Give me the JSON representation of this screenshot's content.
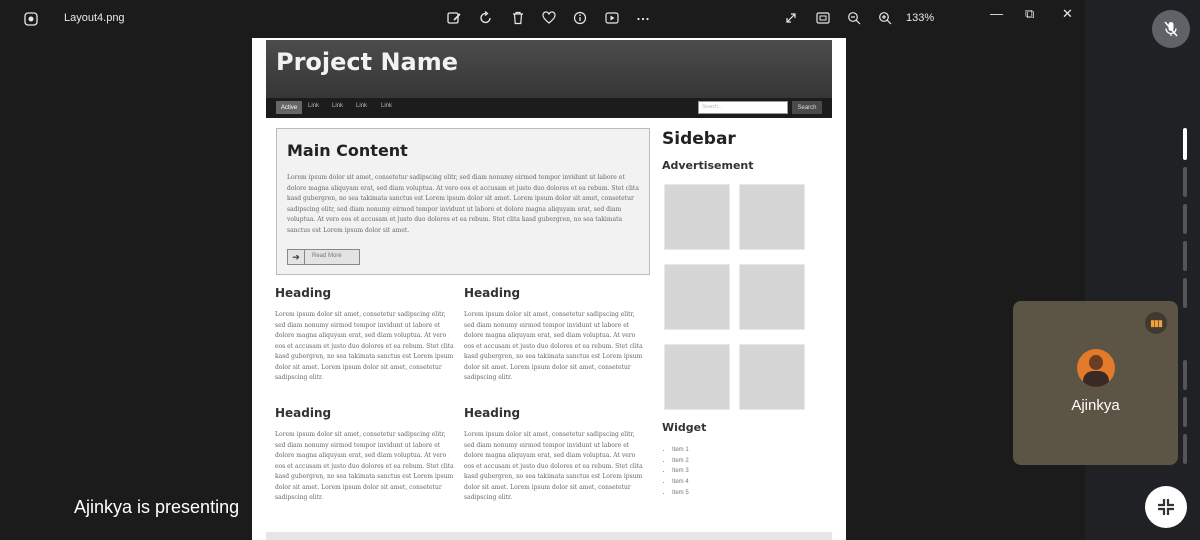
{
  "viewer": {
    "filename": "Layout4.png",
    "zoom": "133%",
    "toolbar_icons": [
      "edit-image-icon",
      "rotate-icon",
      "delete-icon",
      "favorite-icon",
      "info-icon",
      "slideshow-icon",
      "more-icon"
    ],
    "right_icons": [
      "fullscreen-icon",
      "fit-screen-icon",
      "zoom-out-icon",
      "zoom-in-icon"
    ],
    "window_controls": {
      "minimize": "—",
      "restore": "⧉",
      "close": "✕"
    }
  },
  "layout": {
    "project_name": "Project Name",
    "nav": {
      "active": "Active",
      "links": [
        "Link",
        "Link",
        "Link",
        "Link"
      ],
      "search_placeholder": "Search...",
      "search_button": "Search"
    },
    "main": {
      "title": "Main Content",
      "text": "Lorem ipsum dolor sit amet, consetetur sadipscing elitr, sed diam nonumy eirmod tempor invidunt ut labore et dolore magna aliquyam erat, sed diam voluptua. At vero eos et accusam et justo duo dolores et ea rebum. Stet clita kasd gubergren, no sea takimata sanctus est Lorem ipsum dolor sit amet. Lorem ipsum dolor sit amet, consetetur sadipscing elitr, sed diam nonumy eirmod tempor invidunt ut labore et dolore magna aliquyam erat, sed diam voluptua. At vero eos et accusam et justo duo dolores et ea rebum. Stet clita kasd gubergren, no sea takimata sanctus est Lorem ipsum dolor sit amet.",
      "read_more": "Read More"
    },
    "columns": [
      {
        "heading": "Heading",
        "text": "Lorem ipsum dolor sit amet, consetetur sadipscing elitr, sed diam nonumy eirmod tempor invidunt ut labore et dolore magna aliquyam erat, sed diam voluptua. At vero eos et accusam et justo duo dolores et ea rebum. Stet clita kasd gubergren, no sea takimata sanctus est Lorem ipsum dolor sit amet. Lorem ipsum dolor sit amet, consetetur sadipscing elitr."
      },
      {
        "heading": "Heading",
        "text": "Lorem ipsum dolor sit amet, consetetur sadipscing elitr, sed diam nonumy eirmod tempor invidunt ut labore et dolore magna aliquyam erat, sed diam voluptua. At vero eos et accusam et justo duo dolores et ea rebum. Stet clita kasd gubergren, no sea takimata sanctus est Lorem ipsum dolor sit amet. Lorem ipsum dolor sit amet, consetetur sadipscing elitr."
      },
      {
        "heading": "Heading",
        "text": "Lorem ipsum dolor sit amet, consetetur sadipscing elitr, sed diam nonumy eirmod tempor invidunt ut labore et dolore magna aliquyam erat, sed diam voluptua. At vero eos et accusam et justo duo dolores et ea rebum. Stet clita kasd gubergren, no sea takimata sanctus est Lorem ipsum dolor sit amet. Lorem ipsum dolor sit amet, consetetur sadipscing elitr."
      },
      {
        "heading": "Heading",
        "text": "Lorem ipsum dolor sit amet, consetetur sadipscing elitr, sed diam nonumy eirmod tempor invidunt ut labore et dolore magna aliquyam erat, sed diam voluptua. At vero eos et accusam et justo duo dolores et ea rebum. Stet clita kasd gubergren, no sea takimata sanctus est Lorem ipsum dolor sit amet. Lorem ipsum dolor sit amet, consetetur sadipscing elitr."
      }
    ],
    "sidebar": {
      "title": "Sidebar",
      "advertisement": "Advertisement",
      "widget": "Widget",
      "items": [
        "Item 1",
        "Item 2",
        "Item 3",
        "Item 4",
        "Item 5"
      ]
    }
  },
  "meeting": {
    "presenting_text": "Ajinkya is presenting",
    "participant_name": "Ajinkya",
    "accent_audio": "#f2a43a",
    "tile_color": "#5c5545"
  }
}
